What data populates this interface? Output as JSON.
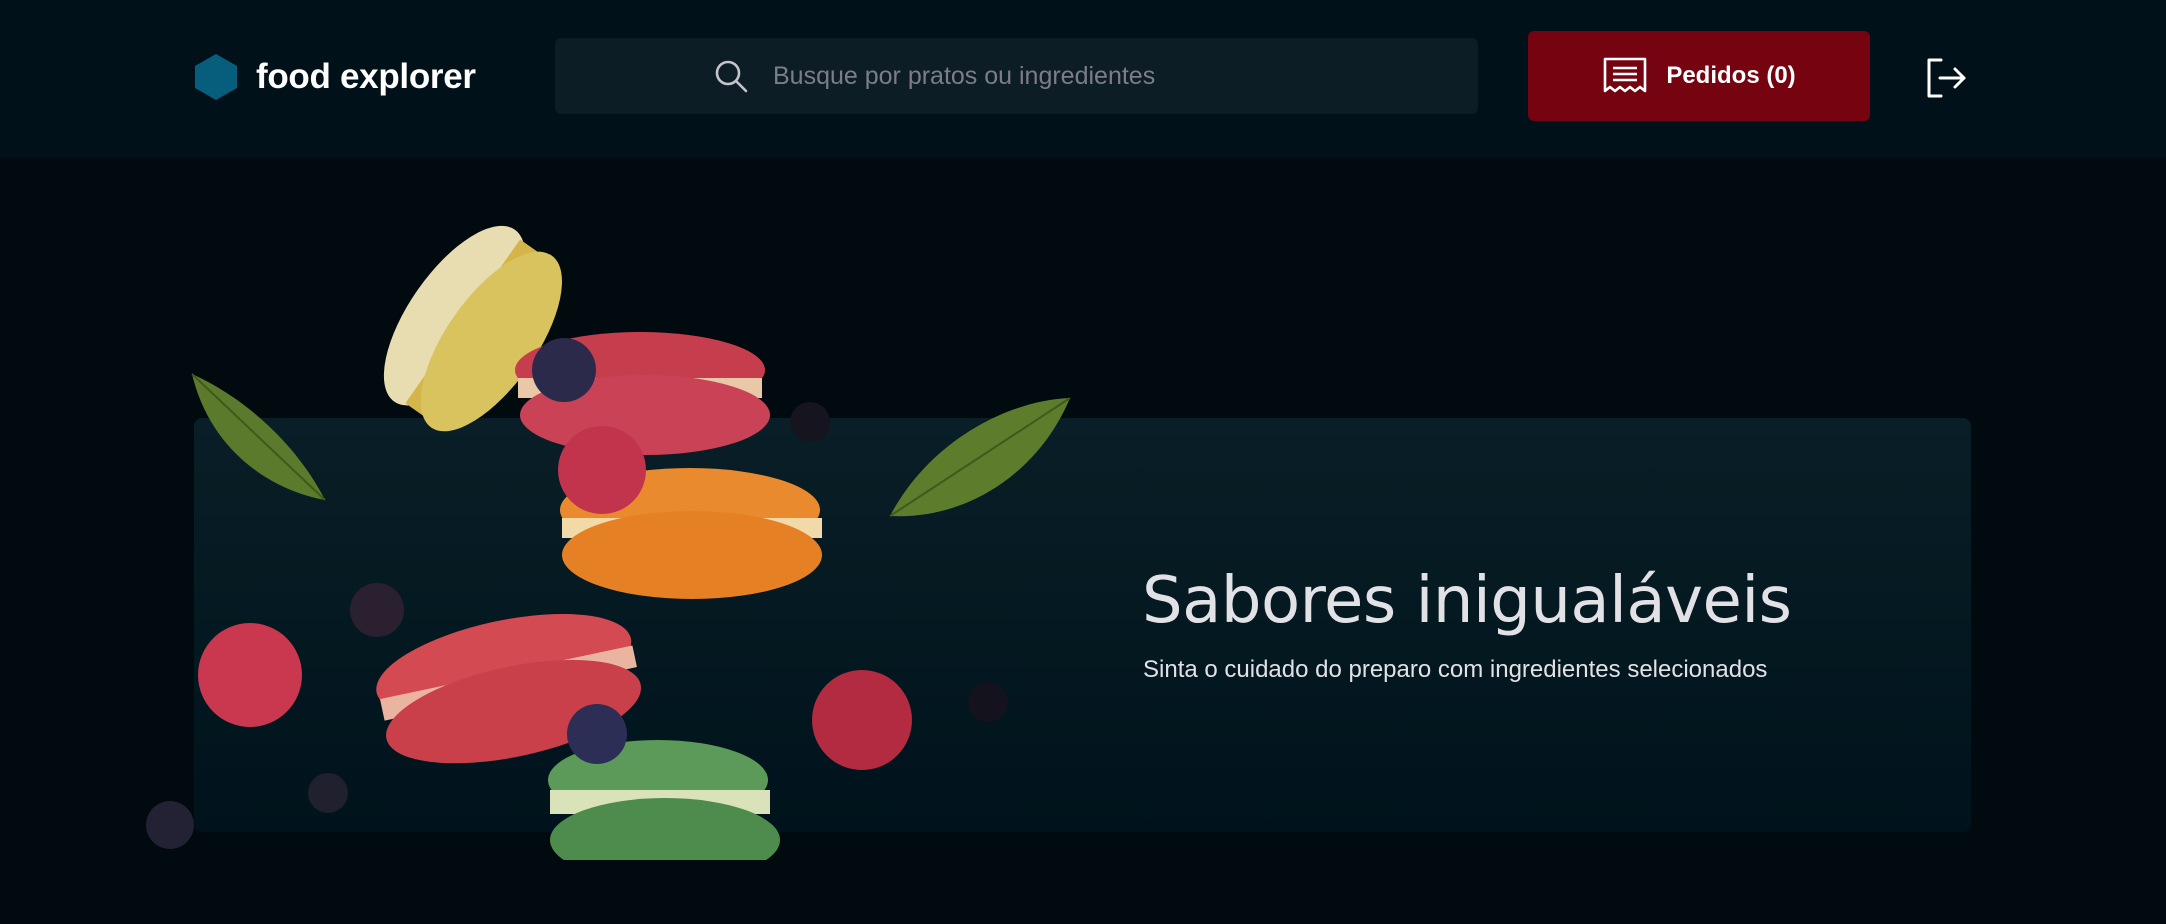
{
  "header": {
    "brand_name": "food explorer",
    "logo_icon": "hexagon-logo-icon",
    "search": {
      "placeholder": "Busque por pratos ou ingredientes",
      "value": "",
      "icon": "search-icon"
    },
    "orders_button": {
      "label": "Pedidos (0)",
      "icon": "receipt-icon"
    },
    "logout_icon": "sign-out-icon"
  },
  "hero": {
    "title": "Sabores inigualáveis",
    "subtitle": "Sinta o cuidado do preparo com ingredientes selecionados",
    "image_subject": "falling-macarons-with-berries-and-leaves"
  },
  "colors": {
    "page_background": "#000A0F",
    "header_background": "#00111A",
    "search_background": "#0D1D25",
    "accent": "#750310",
    "logo": "#065E7C",
    "banner_background": "#091E26",
    "text_light": "#E1E1E6",
    "placeholder": "#7C7C8A"
  }
}
